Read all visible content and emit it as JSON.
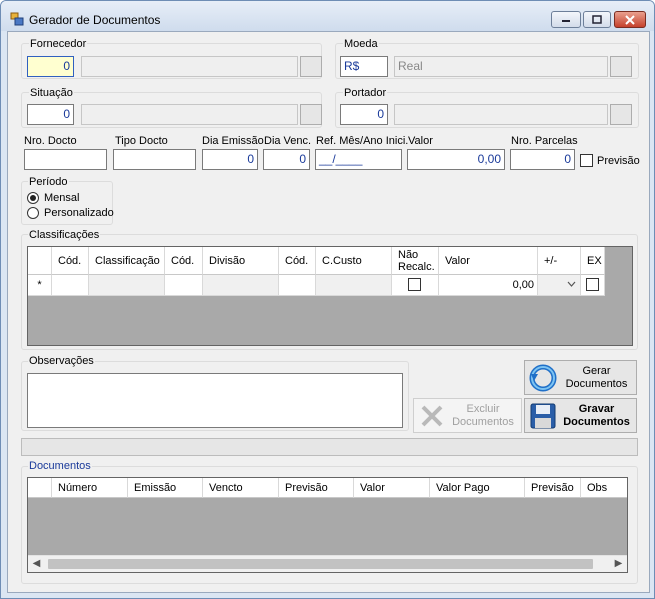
{
  "window": {
    "title": "Gerador de Documentos",
    "icon": "app-forms-icon",
    "buttons": [
      "minimize-icon",
      "maximize-icon",
      "close-icon"
    ]
  },
  "fornecedor": {
    "label": "Fornecedor",
    "code": "0",
    "name": ""
  },
  "moeda": {
    "label": "Moeda",
    "code": "R$",
    "name": "Real"
  },
  "situacao": {
    "label": "Situação",
    "code": "0",
    "name": ""
  },
  "portador": {
    "label": "Portador",
    "code": "0",
    "name": ""
  },
  "doc_fields": {
    "nro_docto": {
      "label": "Nro. Docto",
      "value": ""
    },
    "tipo_docto": {
      "label": "Tipo Docto",
      "value": ""
    },
    "dia_emissao": {
      "label": "Dia Emissão",
      "value": "0"
    },
    "dia_venc": {
      "label": "Dia Venc.",
      "value": "0"
    },
    "ref_mes_ano": {
      "label": "Ref. Mês/Ano Inici.",
      "value": "__/____"
    },
    "valor": {
      "label": "Valor",
      "value": "0,00"
    },
    "nro_parcelas": {
      "label": "Nro. Parcelas",
      "value": "0"
    },
    "previsao": {
      "label": "Previsão",
      "checked": false
    }
  },
  "periodo": {
    "label": "Período",
    "options": [
      {
        "label": "Mensal",
        "selected": true
      },
      {
        "label": "Personalizado",
        "selected": false
      }
    ]
  },
  "classificacoes": {
    "label": "Classificações",
    "columns": [
      "Cód.",
      "Classificação",
      "Cód.",
      "Divisão",
      "Cód.",
      "C.Custo",
      "Não Recalc.",
      "Valor",
      "+/-",
      "EX"
    ],
    "new_row": {
      "marker": "*",
      "valor": "0,00",
      "nao_recalc": false,
      "ex": false,
      "sign": ""
    }
  },
  "observacoes": {
    "label": "Observações",
    "value": ""
  },
  "buttons": {
    "gerar": "Gerar Documentos",
    "excluir": "Excluir Documentos",
    "gravar": "Gravar Documentos"
  },
  "documentos": {
    "label": "Documentos",
    "columns": [
      "Número",
      "Emissão",
      "Vencto",
      "Previsão",
      "Valor",
      "Valor Pago",
      "Previsão",
      "Obs"
    ]
  }
}
